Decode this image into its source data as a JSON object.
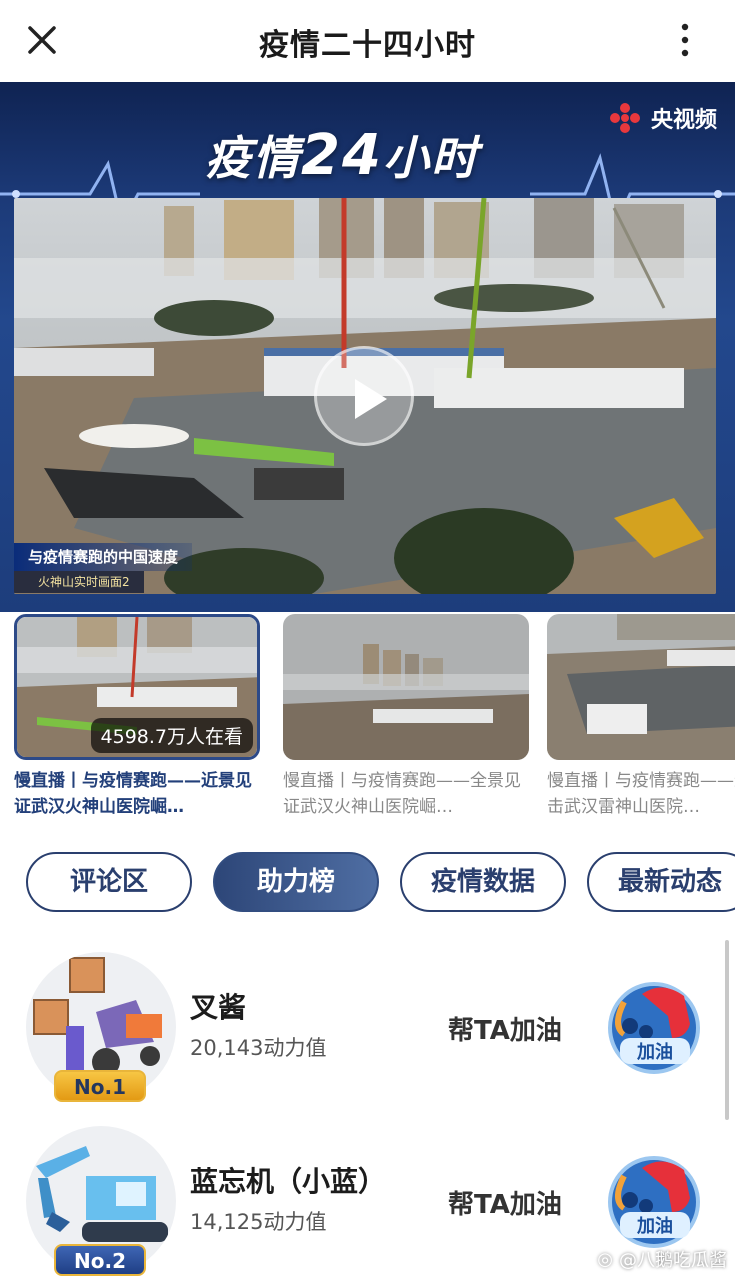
{
  "topbar": {
    "title": "疫情二十四小时"
  },
  "banner": {
    "logo_prefix": "疫情",
    "logo_num": "24",
    "logo_suffix": "小时",
    "brand": "央视频"
  },
  "video": {
    "caption_main": "与疫情赛跑的中国速度",
    "caption_sub": "火神山实时画面2"
  },
  "thumbnails": [
    {
      "viewers": "4598.7万人在看",
      "caption": "慢直播丨与疫情赛跑——近景见证武汉火神山医院崛…"
    },
    {
      "caption": "慢直播丨与疫情赛跑——全景见证武汉火神山医院崛…"
    },
    {
      "caption": "慢直播丨与疫情赛跑——近景直击武汉雷神山医院…"
    }
  ],
  "tabs": [
    {
      "label": "评论区"
    },
    {
      "label": "助力榜"
    },
    {
      "label": "疫情数据"
    },
    {
      "label": "最新动态"
    }
  ],
  "ranking": [
    {
      "rank": "No.1",
      "name": "叉酱",
      "score": "20,143动力值",
      "cheer_label": "帮TA加油",
      "cheer_button": "加油"
    },
    {
      "rank": "No.2",
      "name": "蓝忘机（小蓝）",
      "score": "14,125动力值",
      "cheer_label": "帮TA加油",
      "cheer_button": "加油"
    }
  ],
  "watermark": "@八鹅吃瓜酱",
  "colors": {
    "accent": "#2a3f6e",
    "banner": "#1c3a78",
    "gold": "#f7c644"
  }
}
